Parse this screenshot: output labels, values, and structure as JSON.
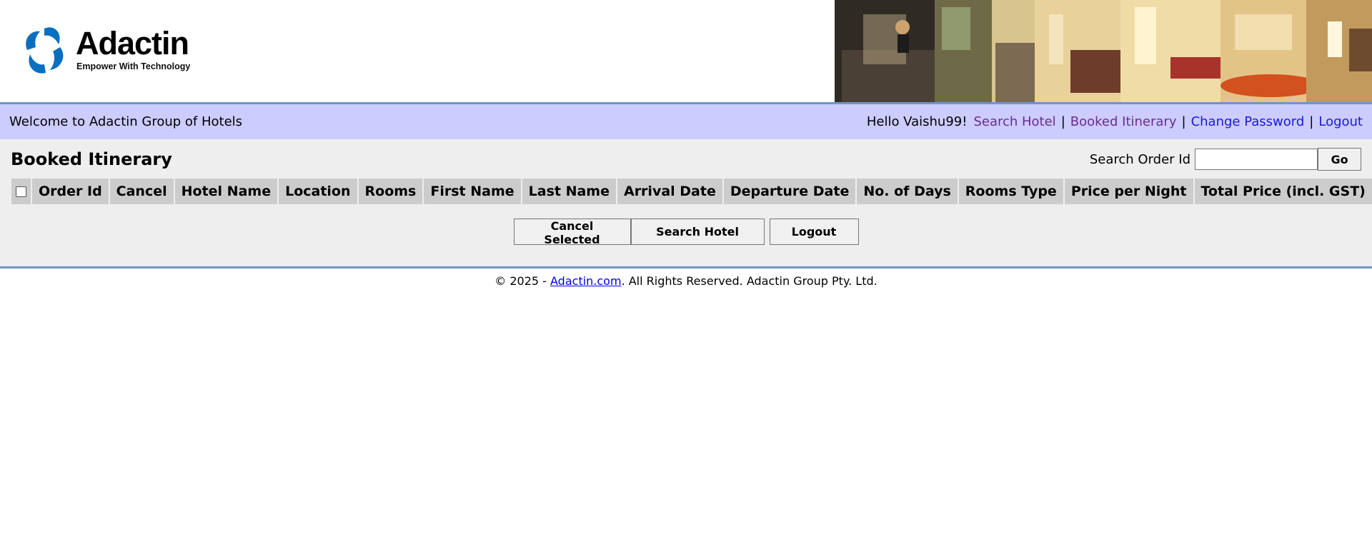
{
  "brand": {
    "name": "Adactin",
    "tagline": "Empower With Technology",
    "logo_color": "#0a6fc0"
  },
  "welcome": {
    "text": "Welcome to Adactin Group of Hotels",
    "hello": "Hello Vaishu99!",
    "links": {
      "search_hotel": "Search Hotel",
      "booked_itinerary": "Booked Itinerary",
      "change_password": "Change Password",
      "logout": "Logout"
    },
    "separator": "|"
  },
  "main": {
    "title": "Booked Itinerary",
    "search_label": "Search Order Id",
    "search_value": "",
    "go_label": "Go",
    "columns": [
      "Order Id",
      "Cancel",
      "Hotel Name",
      "Location",
      "Rooms",
      "First Name",
      "Last Name",
      "Arrival Date",
      "Departure Date",
      "No. of Days",
      "Rooms Type",
      "Price per Night",
      "Total Price (incl. GST)"
    ],
    "actions": {
      "cancel_selected": "Cancel Selected",
      "search_hotel": "Search Hotel",
      "logout": "Logout"
    }
  },
  "footer": {
    "prefix": "© 2025 - ",
    "link": "Adactin.com",
    "suffix": ". All Rights Reserved. Adactin Group Pty. Ltd."
  },
  "colors": {
    "welcome_bar": "#ccccff",
    "main_bg": "#eeeeee",
    "header_cell": "#cccccc",
    "divider": "#6f95c8"
  }
}
